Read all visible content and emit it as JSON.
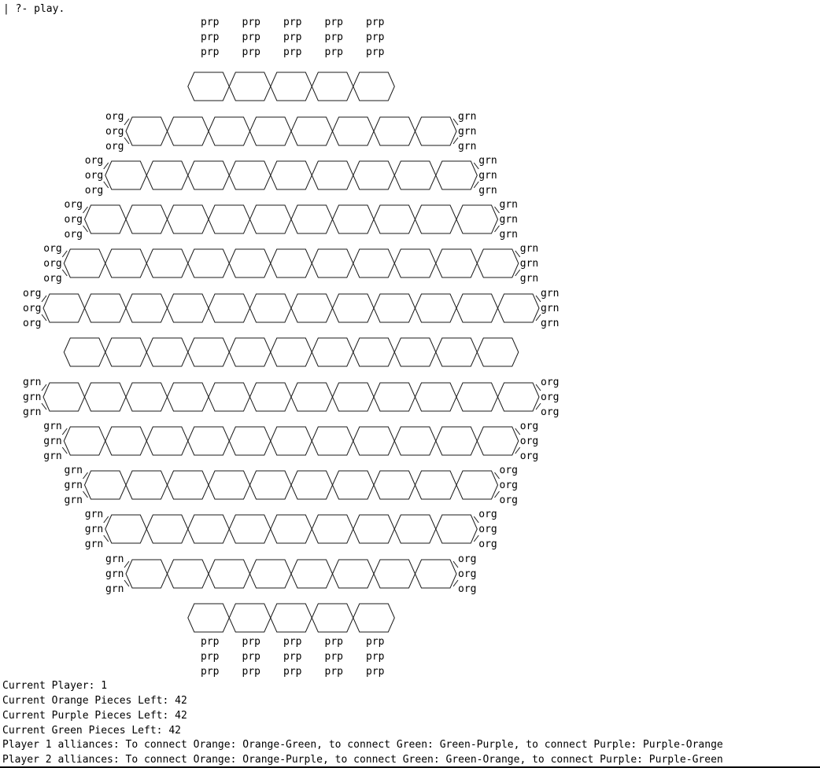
{
  "console": {
    "prompt": "| ?- play."
  },
  "board": {
    "cell_rows": [
      5,
      8,
      9,
      10,
      11,
      12,
      11,
      12,
      11,
      10,
      9,
      8,
      5
    ],
    "purple_label": "prp",
    "orange_label": "org",
    "green_label": "grn",
    "top_purple_rows": [
      [
        "prp",
        "prp",
        "prp",
        "prp",
        "prp"
      ],
      [
        "prp",
        "prp",
        "prp",
        "prp",
        "prp"
      ],
      [
        "prp",
        "prp",
        "prp",
        "prp",
        "prp"
      ]
    ],
    "bottom_purple_rows": [
      [
        "prp",
        "prp",
        "prp",
        "prp",
        "prp"
      ],
      [
        "prp",
        "prp",
        "prp",
        "prp",
        "prp"
      ],
      [
        "prp",
        "prp",
        "prp",
        "prp",
        "prp"
      ]
    ],
    "upper_left_stacks": [
      [
        "org",
        "org",
        "org"
      ],
      [
        "org",
        "org",
        "org"
      ],
      [
        "org",
        "org",
        "org"
      ],
      [
        "org",
        "org",
        "org"
      ],
      [
        "org",
        "org",
        "org"
      ]
    ],
    "upper_right_stacks": [
      [
        "grn",
        "grn",
        "grn"
      ],
      [
        "grn",
        "grn",
        "grn"
      ],
      [
        "grn",
        "grn",
        "grn"
      ],
      [
        "grn",
        "grn",
        "grn"
      ],
      [
        "grn",
        "grn",
        "grn"
      ]
    ],
    "lower_left_stacks": [
      [
        "grn",
        "grn",
        "grn"
      ],
      [
        "grn",
        "grn",
        "grn"
      ],
      [
        "grn",
        "grn",
        "grn"
      ],
      [
        "grn",
        "grn",
        "grn"
      ],
      [
        "grn",
        "grn",
        "grn"
      ]
    ],
    "lower_right_stacks": [
      [
        "org",
        "org",
        "org"
      ],
      [
        "org",
        "org",
        "org"
      ],
      [
        "org",
        "org",
        "org"
      ],
      [
        "org",
        "org",
        "org"
      ],
      [
        "org",
        "org",
        "org"
      ]
    ]
  },
  "status": {
    "current_player": "Current Player: 1",
    "orange_left": "Current Orange Pieces Left: 42",
    "purple_left": "Current Purple Pieces Left: 42",
    "green_left": "Current Green Pieces Left: 42",
    "player1_alliances": "Player 1 alliances: To connect Orange: Orange-Green, to connect Green: Green-Purple, to connect Purple: Purple-Orange",
    "player2_alliances": "Player 2 alliances: To connect Orange: Orange-Purple, to connect Green: Green-Orange, to connect Purple: Purple-Green"
  }
}
